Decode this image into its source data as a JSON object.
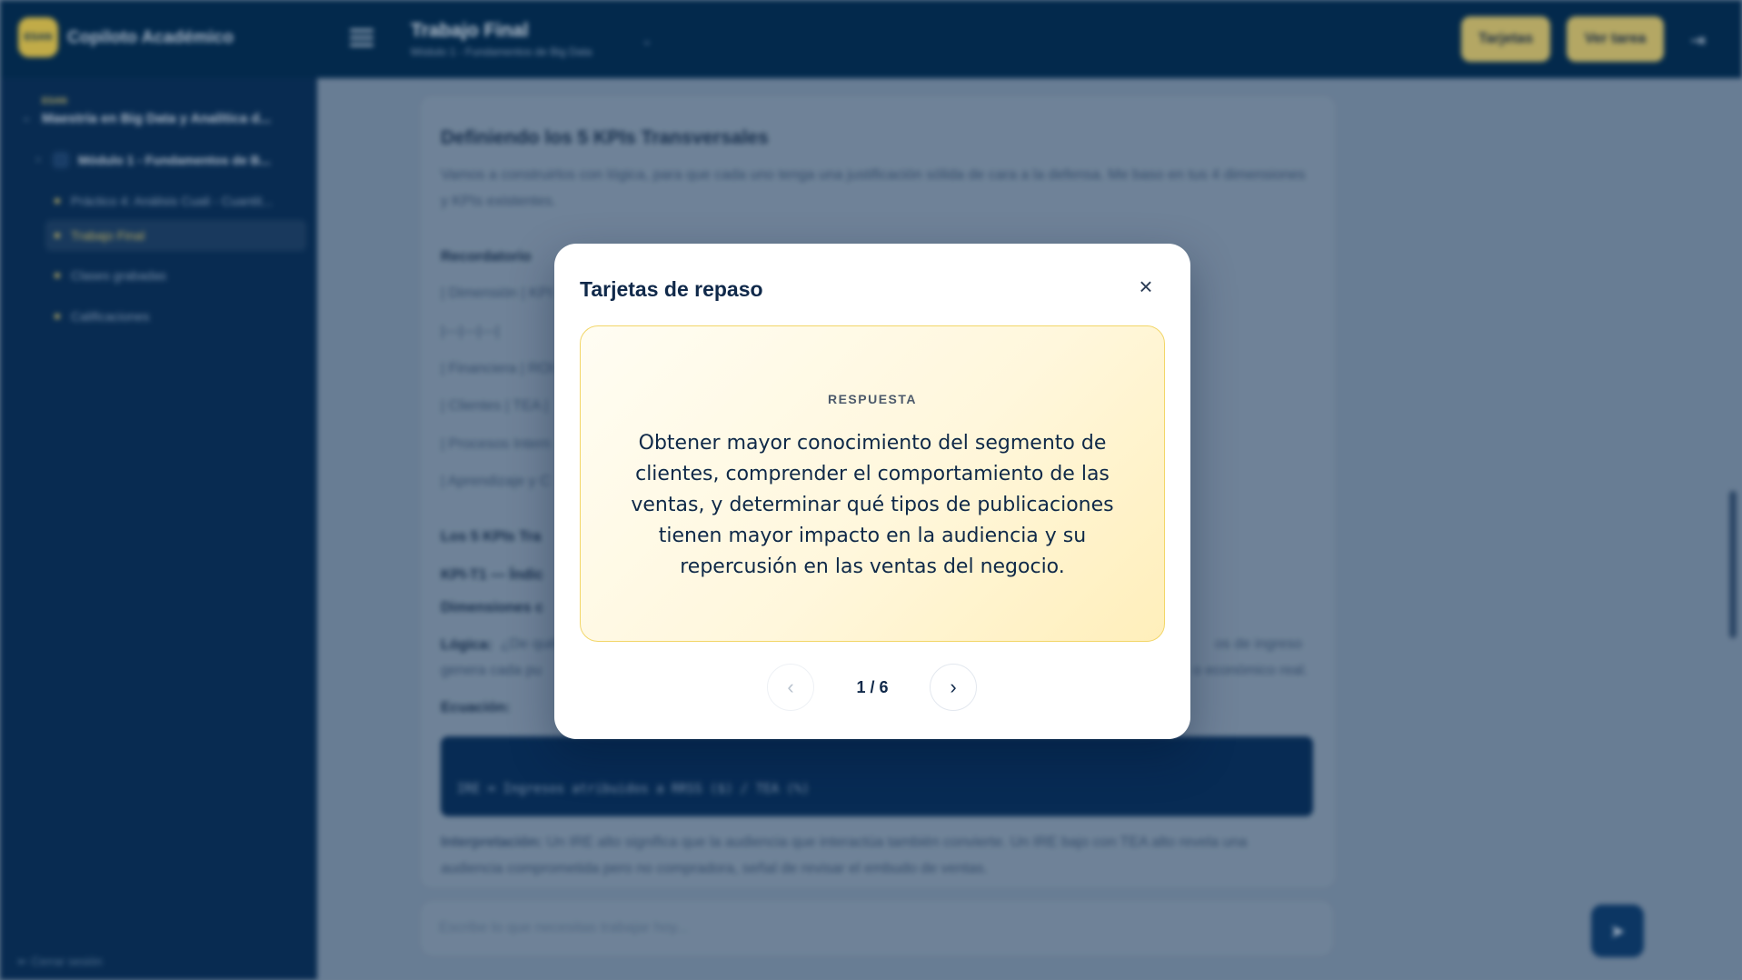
{
  "app": {
    "logo_text": "ESAN",
    "name": "Copiloto Académico"
  },
  "header": {
    "task_title": "Trabajo Final",
    "task_subtitle": "Módulo 1 - Fundamentos de Big Data",
    "buttons": {
      "cards": "Tarjetas",
      "view_task": "Ver tarea"
    }
  },
  "sidebar": {
    "program_tag": "ESAN",
    "program": "Maestría en Big Data y Analítica d...",
    "module": "Módulo 1 - Fundamentos de B...",
    "items": [
      {
        "label": "Práctico 4: Análisis Cuali - Cuantit...",
        "active": false
      },
      {
        "label": "Trabajo Final",
        "active": true
      },
      {
        "label": "Clases grabadas",
        "active": false
      },
      {
        "label": "Calificaciones",
        "active": false
      }
    ],
    "logout": "Cerrar sesión"
  },
  "content": {
    "heading": "Definiendo los 5 KPIs Transversales",
    "intro": "Vamos a construirlos con lógica, para que cada uno tenga una justificación sólida de cara a la defensa. Me baso en tus 4 dimensiones y KPIs existentes.",
    "recordatorio": "Recordatorio",
    "table_rows": [
      "| Dimensión | KPI",
      "|---|---|---|",
      "| Financiera | ROI",
      "| Clientes | TEA |",
      "| Procesos Intern",
      "| Aprendizaje y C"
    ],
    "section_title": "Los 5 KPIs Tra",
    "kpi_title": "KPI-T1 — Índic",
    "dimensiones": "Dimensiones c",
    "logica_label": "Lógica:",
    "logica_text": "¿De qué",
    "logica_right_1": "os de ingreso",
    "logica_right_2": "genera cada pu",
    "logica_right_3": "o económico real.",
    "ecuacion": "Ecuación:",
    "code": "IRE = Ingresos atribuidos a RRSS ($) / TEA (%)",
    "interpretacion_label": "Interpretación:",
    "interpretacion_text": "Un IRE alto significa que la audiencia que interactúa también convierte. Un IRE bajo con TEA alto revela una audiencia comprometida pero no compradora, señal de revisar el embudo de ventas."
  },
  "chat": {
    "placeholder": "Escribe lo que necesitas trabajar hoy..."
  },
  "modal": {
    "title": "Tarjetas de repaso",
    "card_label": "RESPUESTA",
    "card_text": "Obtener mayor conocimiento del segmento de clientes, comprender el comportamiento de las ventas, y determinar qué tipos de publicaciones tienen mayor impacto en la audiencia y su repercusión en las ventas del negocio.",
    "counter": "1 / 6",
    "prev_symbol": "‹",
    "next_symbol": "›",
    "close_symbol": "×"
  },
  "colors": {
    "navy": "#002a4f",
    "accent_gold": "#d8c46c",
    "card_border": "#f2d668",
    "card_bg": "#fff7dc"
  },
  "icons": {
    "close": "close-icon",
    "prev": "chevron-left-icon",
    "next": "chevron-right-icon",
    "menu": "menu-icon",
    "send": "send-icon",
    "logout": "logout-icon"
  }
}
